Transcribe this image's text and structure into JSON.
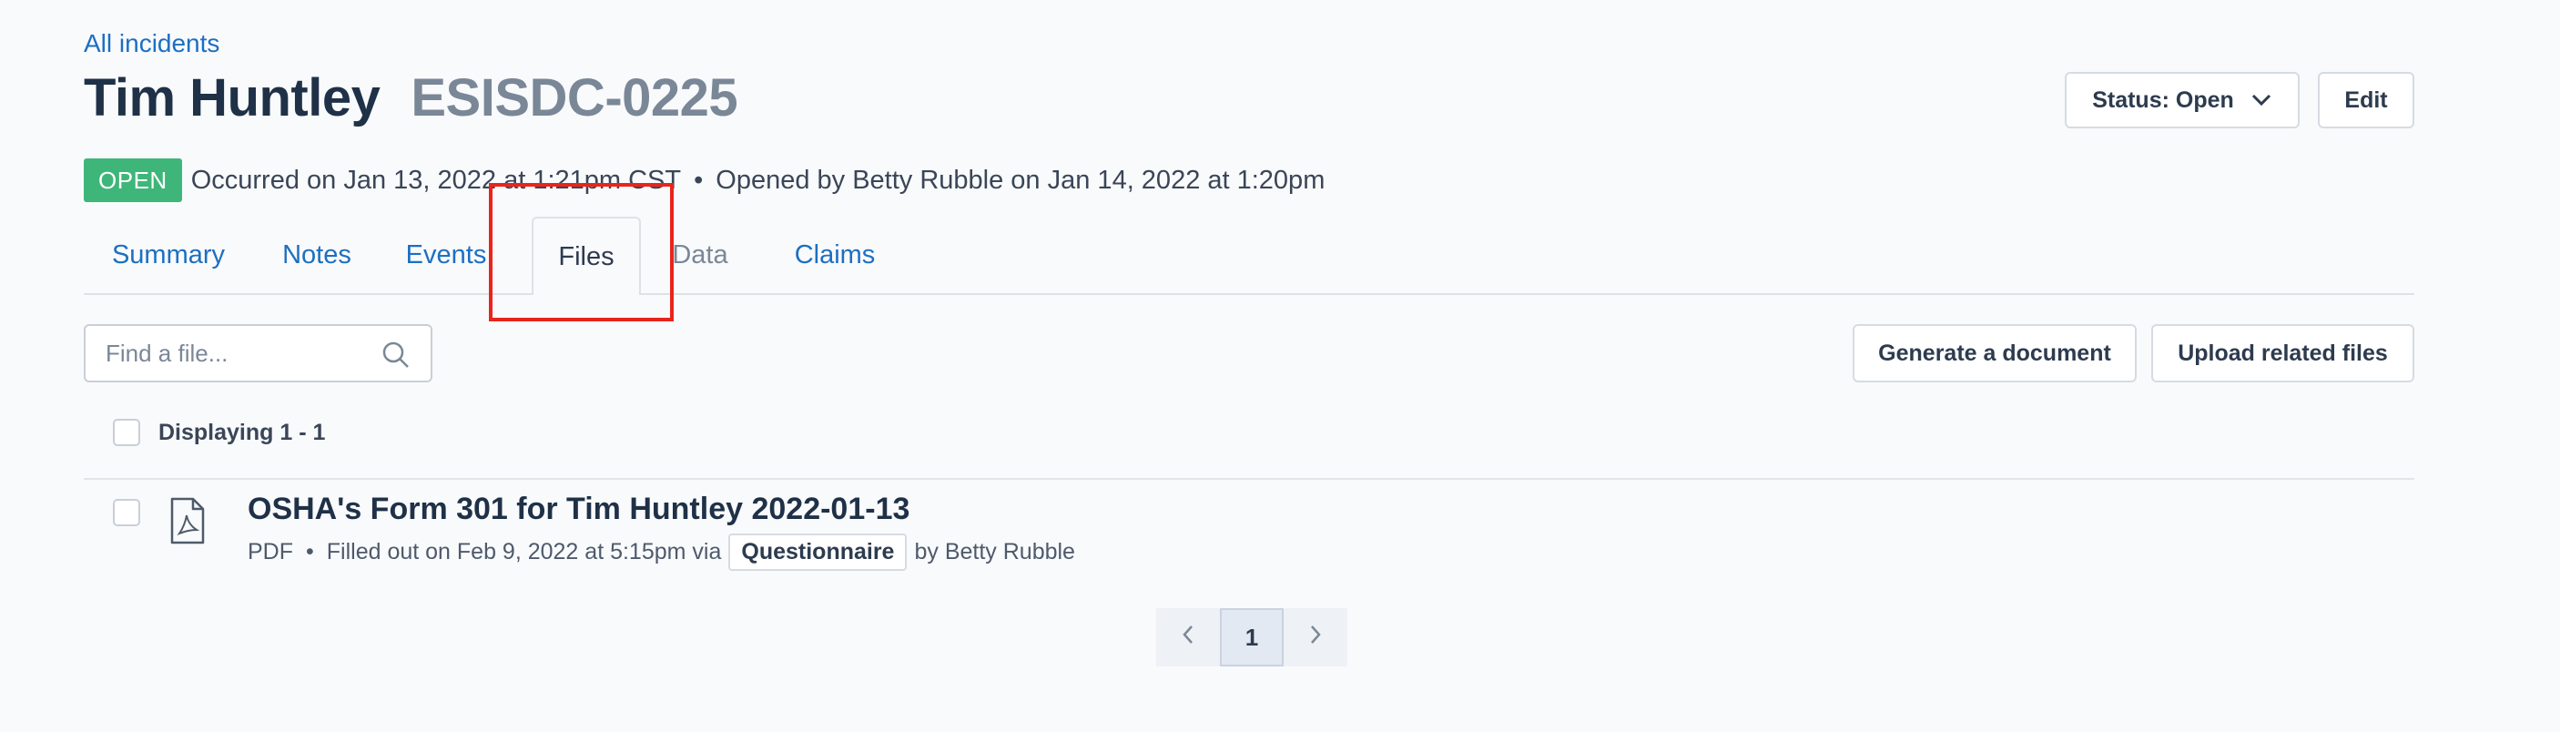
{
  "breadcrumb": {
    "label": "All incidents"
  },
  "header": {
    "name": "Tim Huntley",
    "incident_id": "ESISDC-0225",
    "status_button": "Status: Open",
    "edit_button": "Edit"
  },
  "meta": {
    "badge": "OPEN",
    "occurred": "Occurred on Jan 13, 2022 at 1:21pm CST",
    "separator": "•",
    "opened": "Opened by Betty Rubble on Jan 14, 2022 at 1:20pm"
  },
  "tabs": [
    {
      "label": "Summary"
    },
    {
      "label": "Notes"
    },
    {
      "label": "Events"
    },
    {
      "label": "Files"
    },
    {
      "label": "Data"
    },
    {
      "label": "Claims"
    }
  ],
  "active_tab": "Files",
  "toolbar": {
    "search_placeholder": "Find a file...",
    "generate_button": "Generate a document",
    "upload_button": "Upload related files"
  },
  "list": {
    "displaying": "Displaying 1 - 1",
    "files": [
      {
        "title": "OSHA's Form 301 for Tim Huntley 2022-01-13",
        "type": "PDF",
        "separator": "•",
        "filled": "Filled out on Feb 9, 2022 at 5:15pm via",
        "via": "Questionnaire",
        "by": "by Betty Rubble",
        "icon": "pdf-file-icon"
      }
    ]
  },
  "pagination": {
    "current": "1"
  },
  "colors": {
    "link": "#1c6fc2",
    "badge": "#3fb679",
    "highlight": "#e8251c"
  }
}
